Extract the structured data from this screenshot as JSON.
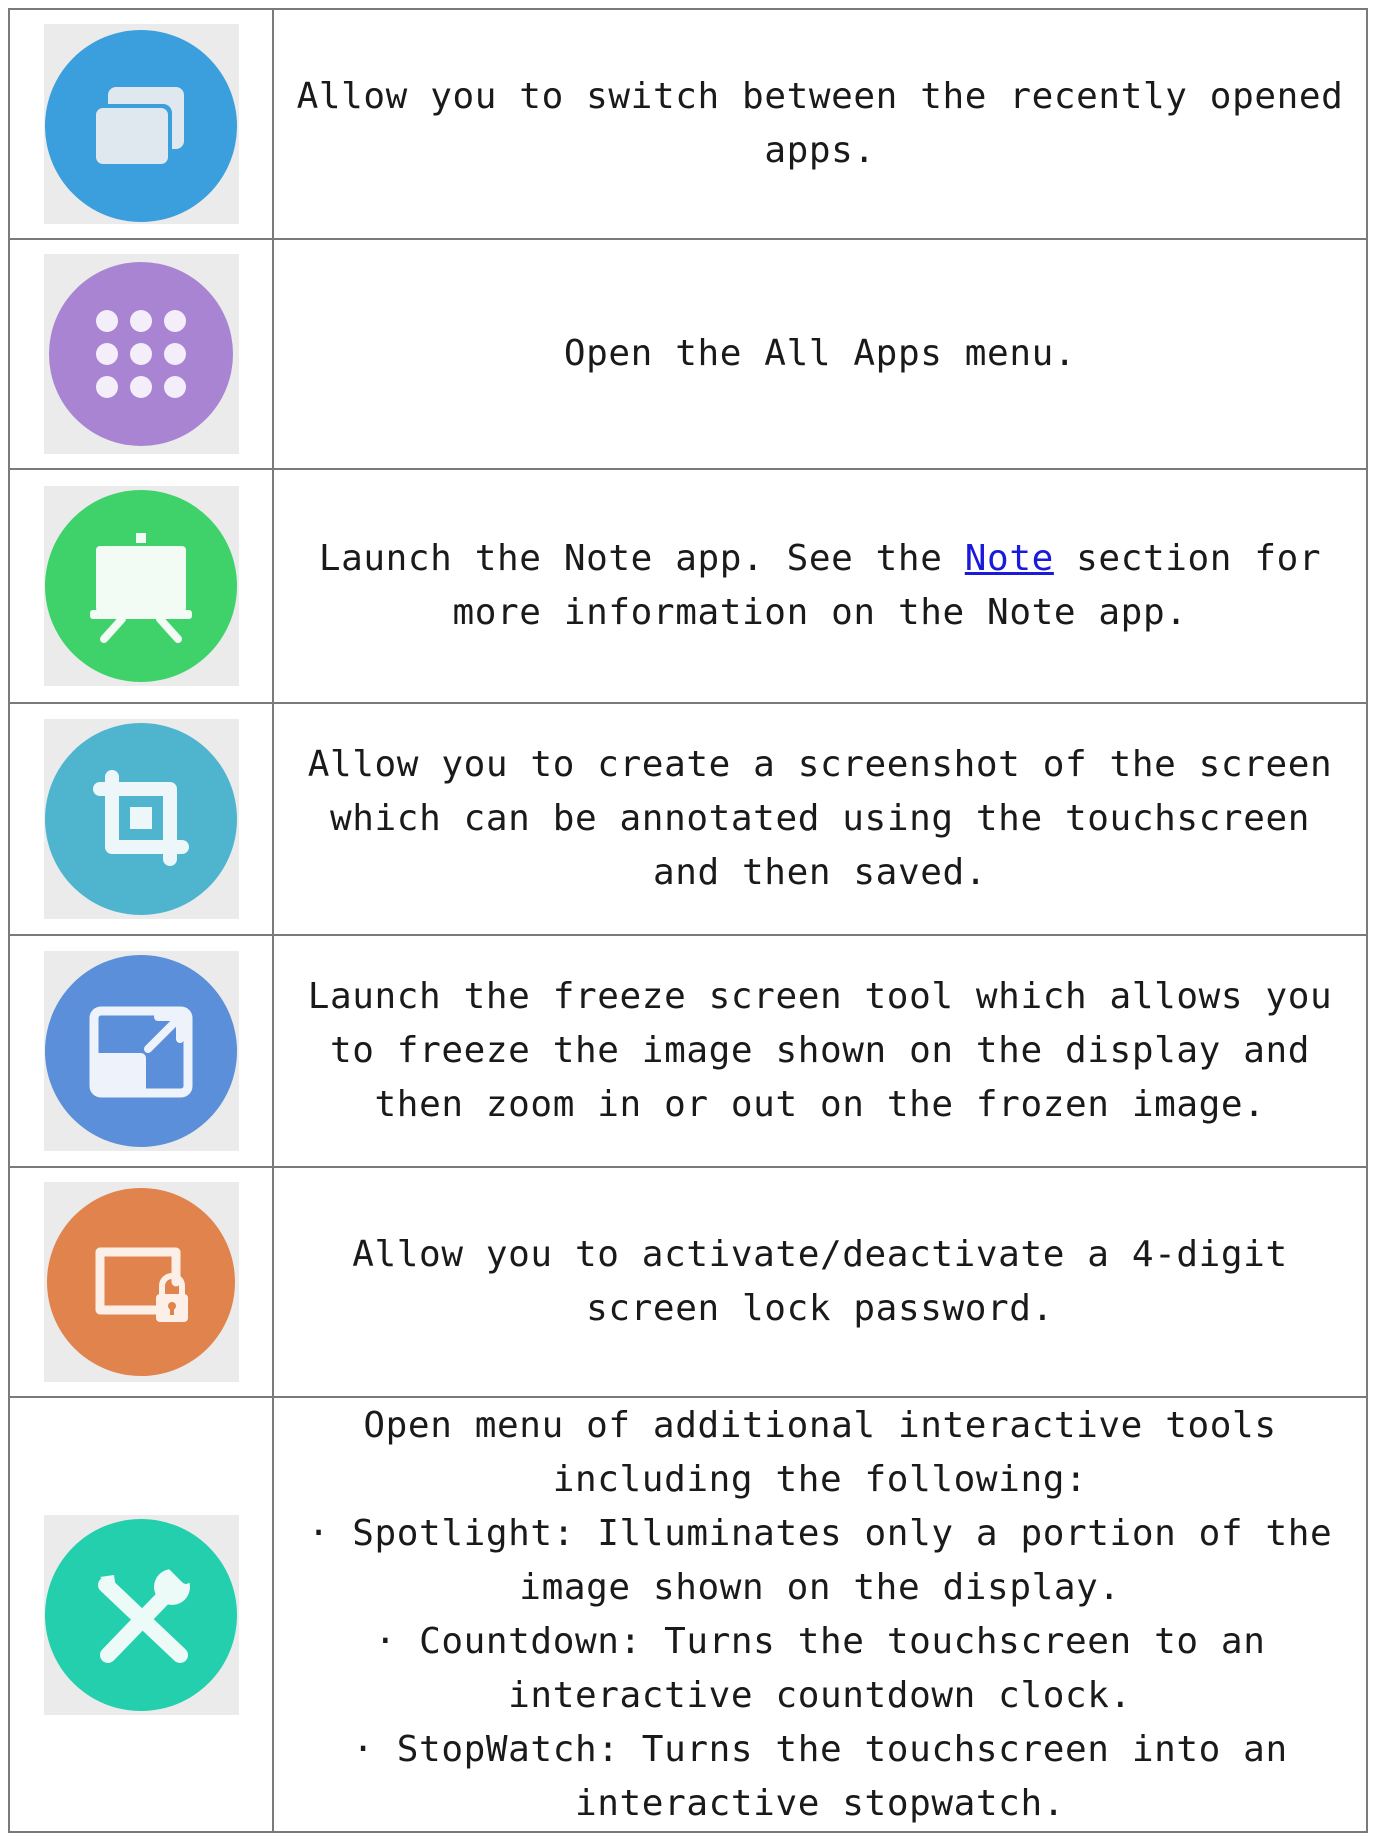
{
  "colors": {
    "recent_apps": "#3a9fdc",
    "all_apps": "#a984d3",
    "note": "#3fd26b",
    "screenshot": "#4fb5cf",
    "freeze": "#5b8fd9",
    "lock": "#e1834d",
    "tools": "#24cfad",
    "icon_tile_bg": "#ebebeb",
    "link": "#1a1adb",
    "border": "#7a7a7a"
  },
  "rows": [
    {
      "icon": "recent-apps-icon",
      "text": "Allow you to switch between the recently opened apps."
    },
    {
      "icon": "all-apps-grid-icon",
      "text": "Open the All Apps menu."
    },
    {
      "icon": "note-easel-icon",
      "text_before": "Launch the Note app. See the ",
      "link_text": "Note",
      "text_after": " section for more information on the Note app."
    },
    {
      "icon": "crop-screenshot-icon",
      "text": "Allow you to create a screenshot of the screen which can be annotated using the touchscreen and then saved."
    },
    {
      "icon": "freeze-zoom-icon",
      "text": "Launch the freeze screen tool which allows you to freeze the image shown on the display and then zoom in or out on the frozen image."
    },
    {
      "icon": "screen-lock-icon",
      "text": "Allow you to activate/deactivate a 4-digit screen lock password."
    },
    {
      "icon": "tools-wrench-screwdriver-icon",
      "intro": "Open menu of additional interactive tools including the following:",
      "items": [
        "·    Spotlight: Illuminates only a portion of the image shown on the display.",
        "·    Countdown: Turns the touchscreen to an interactive countdown clock.",
        "·    StopWatch: Turns the touchscreen into an interactive stopwatch."
      ]
    }
  ]
}
